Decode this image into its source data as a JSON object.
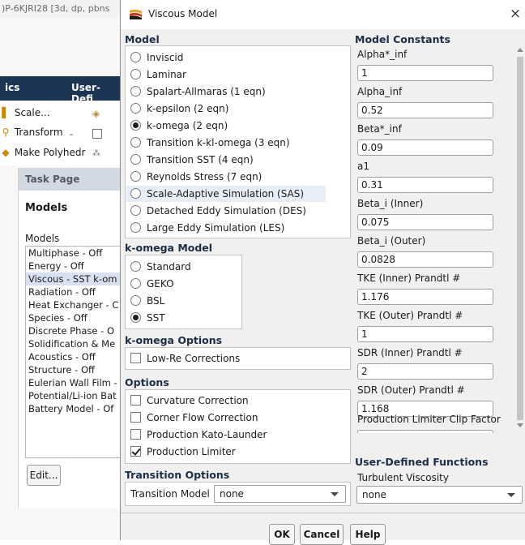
{
  "background": {
    "window_title": ")P-6KJRI28  [3d, dp, pbns",
    "menubar": {
      "item1": "ics",
      "item2": "User-Defi"
    },
    "ribbon": {
      "scale": "Scale...",
      "transform": "Transform",
      "make_polyhedra": "Make Polyhedr"
    },
    "task_page": {
      "header": "Task Page",
      "title": "Models",
      "list_label": "Models",
      "items": [
        "Multiphase - Off",
        "Energy - Off",
        "Viscous - SST k-om",
        "Radiation - Off",
        "Heat Exchanger - C",
        "Species - Off",
        "Discrete Phase - O",
        "Solidification & Me",
        "Acoustics - Off",
        "Structure - Off",
        "Eulerian Wall Film -",
        "Potential/Li-ion Bat",
        "Battery Model - Of"
      ],
      "edit_button": "Edit..."
    }
  },
  "dialog": {
    "title": "Viscous Model",
    "close_glyph": "×",
    "model": {
      "label": "Model",
      "options": [
        "Inviscid",
        "Laminar",
        "Spalart-Allmaras (1 eqn)",
        "k-epsilon (2 eqn)",
        "k-omega (2 eqn)",
        "Transition k-kl-omega (3 eqn)",
        "Transition SST (4 eqn)",
        "Reynolds Stress (7 eqn)",
        "Scale-Adaptive Simulation (SAS)",
        "Detached Eddy Simulation (DES)",
        "Large Eddy Simulation (LES)"
      ],
      "selected": "k-omega (2 eqn)",
      "highlighted": "Scale-Adaptive Simulation (SAS)"
    },
    "komega_model": {
      "label": "k-omega Model",
      "options": [
        "Standard",
        "GEKO",
        "BSL",
        "SST"
      ],
      "selected": "SST"
    },
    "komega_options": {
      "label": "k-omega Options",
      "low_re": "Low-Re Corrections",
      "low_re_checked": false
    },
    "options": {
      "label": "Options",
      "items": [
        {
          "label": "Curvature Correction",
          "checked": false
        },
        {
          "label": "Corner Flow Correction",
          "checked": false
        },
        {
          "label": "Production Kato-Launder",
          "checked": false
        },
        {
          "label": "Production Limiter",
          "checked": true
        }
      ]
    },
    "transition_options": {
      "label": "Transition Options",
      "model_label": "Transition Model",
      "model_value": "none"
    },
    "model_constants": {
      "label": "Model Constants",
      "items": [
        {
          "name": "Alpha*_inf",
          "value": "1"
        },
        {
          "name": "Alpha_inf",
          "value": "0.52"
        },
        {
          "name": "Beta*_inf",
          "value": "0.09"
        },
        {
          "name": "a1",
          "value": "0.31"
        },
        {
          "name": "Beta_i (Inner)",
          "value": "0.075"
        },
        {
          "name": "Beta_i (Outer)",
          "value": "0.0828"
        },
        {
          "name": "TKE (Inner) Prandtl #",
          "value": "1.176"
        },
        {
          "name": "TKE (Outer) Prandtl #",
          "value": "1"
        },
        {
          "name": "SDR (Inner) Prandtl #",
          "value": "2"
        },
        {
          "name": "SDR (Outer) Prandtl #",
          "value": "1.168"
        },
        {
          "name": "Production Limiter Clip Factor",
          "value": ""
        }
      ]
    },
    "udf": {
      "label": "User-Defined Functions",
      "turbulent_viscosity_label": "Turbulent Viscosity",
      "turbulent_viscosity_value": "none"
    },
    "buttons": {
      "ok": "OK",
      "cancel": "Cancel",
      "help": "Help"
    }
  },
  "colors": {
    "menubar": "#1c3554",
    "section_label": "#1b2e45",
    "highlight_row": "#e8eef7",
    "task_selected": "#d8e1ef"
  },
  "icons": [
    "fluent-logo-icon",
    "close-icon",
    "radio-icon",
    "checkbox-icon",
    "dropdown-arrow-icon",
    "scale-icon",
    "transform-icon",
    "polyhedra-icon"
  ]
}
